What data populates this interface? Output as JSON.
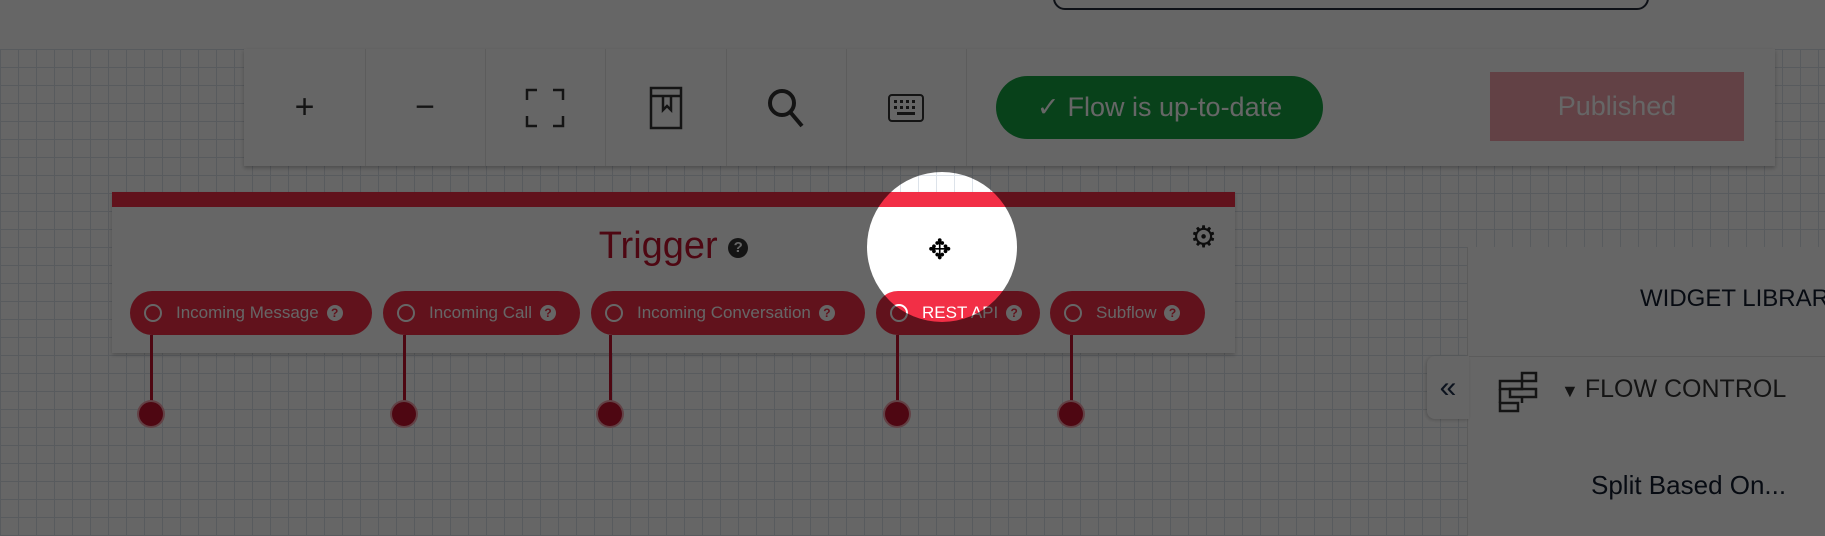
{
  "toolbar": {
    "zoom_in": "+",
    "zoom_out": "−",
    "status": "Flow is up-to-date",
    "publish_label": "Published"
  },
  "trigger": {
    "title": "Trigger",
    "pills": [
      {
        "label": "Incoming Message"
      },
      {
        "label": "Incoming Call"
      },
      {
        "label": "Incoming Conversation"
      },
      {
        "label": "REST API"
      },
      {
        "label": "Subflow"
      }
    ]
  },
  "widget_library": {
    "title": "WIDGET LIBRARY",
    "section": "FLOW CONTROL",
    "item": "Split Based On..."
  },
  "colors": {
    "accent": "#f22f46",
    "success": "#14a342"
  }
}
